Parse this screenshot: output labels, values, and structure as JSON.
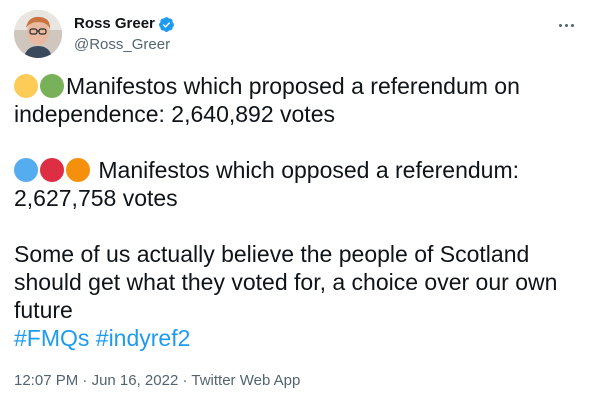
{
  "author": {
    "display_name": "Ross Greer",
    "handle": "@Ross_Greer",
    "verified_icon": "verified-badge-icon"
  },
  "more_icon": "more-horizontal-icon",
  "tweet": {
    "para1_text": "Manifestos which proposed a referendum on independence: 2,640,892 votes",
    "para1_dots": [
      "yellow",
      "green"
    ],
    "para2_text": " Manifestos which opposed a referendum: 2,627,758 votes",
    "para2_dots": [
      "blue",
      "red",
      "orange"
    ],
    "para3_text": "Some of us actually believe the people of Scotland should get what they voted for, a choice over our own future",
    "hashtag1": "#FMQs",
    "hashtag2": "#indyref2"
  },
  "meta": {
    "time": "12:07 PM",
    "separator": " · ",
    "date": "Jun 16, 2022",
    "source": "Twitter Web App"
  },
  "colors": {
    "hashtag": "#1d9bf0",
    "muted": "#536471",
    "verified": "#1d9bf0"
  }
}
